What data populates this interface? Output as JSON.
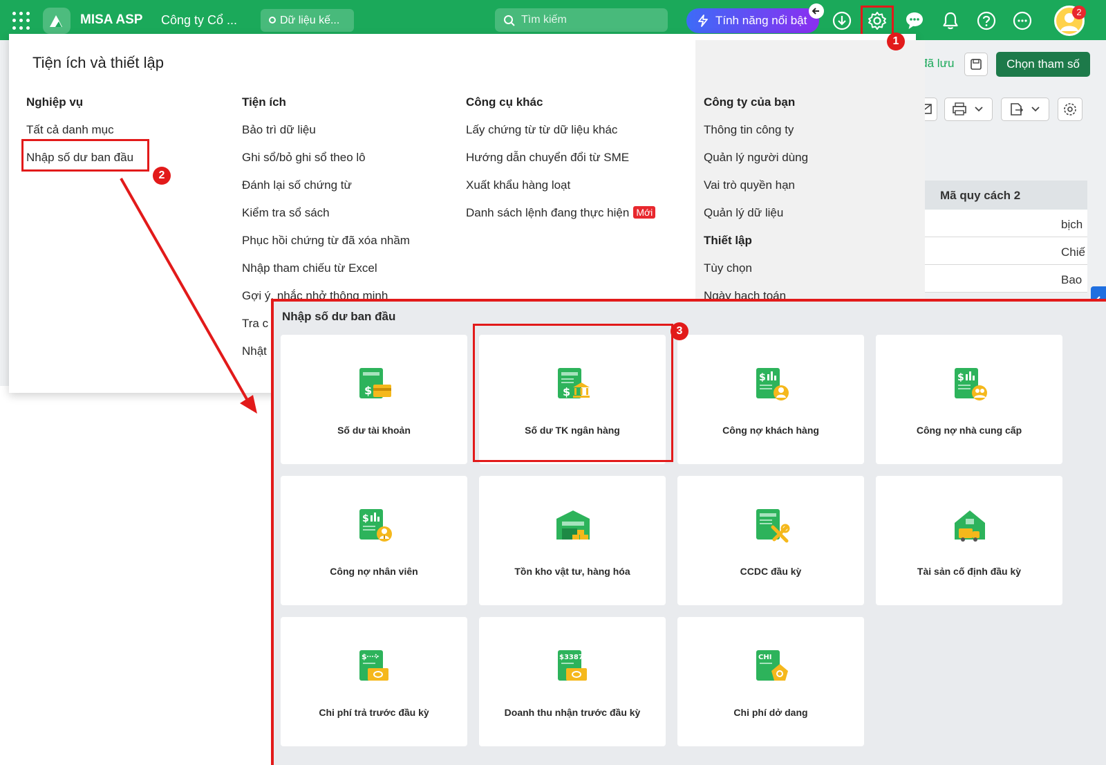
{
  "topbar": {
    "brand": "MISA ASP",
    "company": "Công ty Cổ ...",
    "data_label": "Dữ liệu kế...",
    "search_placeholder": "Tìm kiếm",
    "featured_label": "Tính năng nổi bật",
    "notification_count": "2",
    "icons": [
      "apps-grid-icon",
      "download-icon",
      "gear-icon",
      "chat-icon",
      "bell-icon",
      "help-icon",
      "more-icon"
    ]
  },
  "underlying": {
    "saved_label": "o đã lưu",
    "choose_params_label": "Chọn tham số",
    "column_header": "Mã quy cách 2",
    "rows": [
      "bịch",
      "Chiế",
      "Bao"
    ]
  },
  "menu": {
    "title": "Tiện ích và thiết lập",
    "columns": [
      {
        "heading": "Nghiệp vụ",
        "items": [
          "Tất cả danh mục",
          "Nhập số dư ban đầu"
        ]
      },
      {
        "heading": "Tiện ích",
        "items": [
          "Bảo trì dữ liệu",
          "Ghi sổ/bỏ ghi sổ theo lô",
          "Đánh lại số chứng từ",
          "Kiểm tra sổ sách",
          "Phục hồi chứng từ đã xóa nhầm",
          "Nhập tham chiếu từ Excel",
          "Gợi ý, nhắc nhở thông minh",
          "Tra c",
          "Nhật"
        ]
      },
      {
        "heading": "Công cụ khác",
        "items": [
          "Lấy chứng từ từ dữ liệu khác",
          "Hướng dẫn chuyển đổi từ SME",
          "Xuất khẩu hàng loạt",
          "Danh sách lệnh đang thực hiện"
        ],
        "new_badge": "Mới"
      },
      {
        "heading": "Công ty của bạn",
        "items": [
          "Thông tin công ty",
          "Quản lý người dùng",
          "Vai trò quyền hạn",
          "Quản lý dữ liệu"
        ],
        "heading2": "Thiết lập",
        "items2": [
          "Tùy chọn",
          "Ngày hạch toán"
        ]
      }
    ]
  },
  "callouts": [
    "1",
    "2",
    "3"
  ],
  "panel": {
    "title": "Nhập số dư ban đầu",
    "cards": [
      {
        "label": "Số dư tài khoản",
        "icon": "account-balance-icon"
      },
      {
        "label": "Số dư TK ngân hàng",
        "icon": "bank-balance-icon"
      },
      {
        "label": "Công nợ khách hàng",
        "icon": "customer-debt-icon"
      },
      {
        "label": "Công nợ nhà cung cấp",
        "icon": "supplier-debt-icon"
      },
      {
        "label": "Công nợ nhân viên",
        "icon": "employee-debt-icon"
      },
      {
        "label": "Tồn kho vật tư, hàng hóa",
        "icon": "inventory-icon"
      },
      {
        "label": "CCDC đầu kỳ",
        "icon": "tools-icon"
      },
      {
        "label": "Tài sản cố định đầu kỳ",
        "icon": "fixed-asset-icon"
      },
      {
        "label": "Chi phí trả trước đầu kỳ",
        "icon": "prepaid-expense-icon"
      },
      {
        "label": "Doanh thu nhận trước đầu kỳ",
        "icon": "unearned-revenue-icon"
      },
      {
        "label": "Chi phí dở dang",
        "icon": "wip-cost-icon"
      }
    ],
    "icon_texts": {
      "revenue_code": "$3387",
      "expense_code": "CHI"
    }
  },
  "colors": {
    "brand_green": "#1ba95a",
    "highlight_red": "#e21a1a",
    "icon_green": "#2db35b",
    "icon_yellow": "#f5b81c"
  }
}
